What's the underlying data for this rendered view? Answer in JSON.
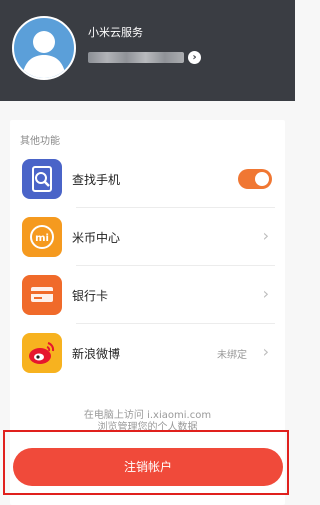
{
  "header": {
    "service_title": "小米云服务"
  },
  "section": {
    "label": "其他功能"
  },
  "items": [
    {
      "label": "查找手机",
      "value": "",
      "toggle_on": true,
      "icon": "find-phone-icon"
    },
    {
      "label": "米币中心",
      "value": "",
      "icon": "mi-coin-icon"
    },
    {
      "label": "银行卡",
      "value": "",
      "icon": "bank-card-icon"
    },
    {
      "label": "新浪微博",
      "value": "未绑定",
      "icon": "weibo-icon"
    }
  ],
  "footer": {
    "line1": "在电脑上访问 i.xiaomi.com",
    "line2": "浏览管理您的个人数据"
  },
  "logout": {
    "label": "注销帐户"
  },
  "colors": {
    "header_bg": "#3a3d43",
    "accent_orange": "#f07733",
    "logout_red": "#f04a3a",
    "highlight_red": "#e0201d"
  }
}
